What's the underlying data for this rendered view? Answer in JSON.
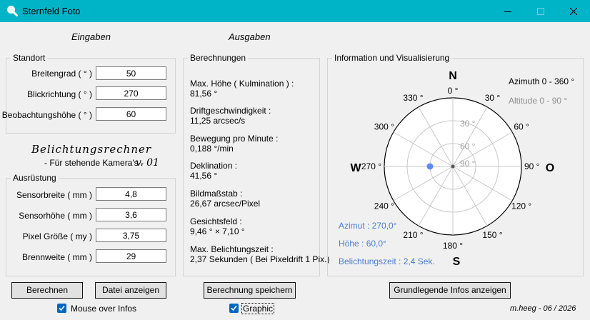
{
  "window": {
    "title": "Sternfeld Foto"
  },
  "headers": {
    "inputs": "Eingaben",
    "outputs": "Ausgaben"
  },
  "standort": {
    "legend": "Standort",
    "fields": [
      {
        "label": "Breitengrad ( ° )",
        "value": "50"
      },
      {
        "label": "Blickrichtung ( ° )",
        "value": "270"
      },
      {
        "label": "Beobachtungshöhe ( ° )",
        "value": "60"
      }
    ]
  },
  "branding": {
    "title": "Belichtungsrechner",
    "subtitle": "- Für stehende Kamera's -",
    "version": "v. 01"
  },
  "ausruestung": {
    "legend": "Ausrüstung",
    "fields": [
      {
        "label": "Sensorbreite ( mm )",
        "value": "4,8"
      },
      {
        "label": "Sensorhöhe ( mm )",
        "value": "3,6"
      },
      {
        "label": "Pixel Größe ( my )",
        "value": "3,75"
      },
      {
        "label": "Brennweite ( mm )",
        "value": "29"
      }
    ]
  },
  "berechnungen": {
    "legend": "Berechnungen",
    "items": [
      {
        "label": "Max. Höhe ( Kulmination ) :",
        "value": "81,56 °"
      },
      {
        "label": "Driftgeschwindigkeit :",
        "value": "11,25 arcsec/s"
      },
      {
        "label": "Bewegung pro Minute :",
        "value": "0,188 °/min"
      },
      {
        "label": "Deklination :",
        "value": "41,56 °"
      },
      {
        "label": "Bildmaßstab :",
        "value": "26,67 arcsec/Pixel"
      },
      {
        "label": "Gesichtsfeld :",
        "value": "9,46 ° × 7,10 °"
      },
      {
        "label": "Max. Belichtungszeit :",
        "value": "2,37 Sekunden ( Bei Pixeldrift 1 Pix.)"
      }
    ]
  },
  "info": {
    "legend": "Information und Visualisierung",
    "azimuth_range": "Azimuth 0 - 360 °",
    "altitude_range": "Altitude 0 - 90 °",
    "azimut_readout": "Azimut : 270,0°",
    "hoehe_readout": "Höhe : 60,0°",
    "exposure_readout": "Belichtungszeit : 2,4 Sek.",
    "cardinals": {
      "n": "N",
      "s": "S",
      "w": "W",
      "o": "O"
    },
    "compass_labels": [
      "0 °",
      "30 °",
      "60 °",
      "90 °",
      "120 °",
      "150 °",
      "180 °",
      "210 °",
      "240 °",
      "270 °",
      "300 °",
      "330 °"
    ],
    "altitude_labels": [
      "30 °",
      "60 °",
      "90 °"
    ],
    "marker": {
      "azimuth_deg": 270,
      "altitude_deg": 60
    },
    "colors": {
      "marker": "#5b8def",
      "readout": "#4a7fd4",
      "grid": "#c8c8c8"
    }
  },
  "buttons": {
    "berechnen": "Berechnen",
    "datei_anzeigen": "Datei anzeigen",
    "speichern": "Berechnung speichern",
    "grundlegende": "Grundlegende Infos  anzeigen"
  },
  "checkboxes": {
    "mouse_over": "Mouse over Infos",
    "graphic": "Graphic"
  },
  "footer": {
    "author": "m.heeg - 06 / 2026"
  }
}
